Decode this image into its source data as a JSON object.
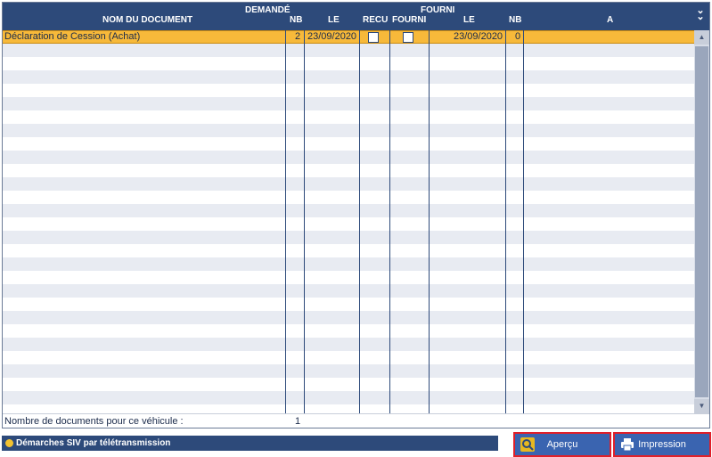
{
  "header": {
    "col_nom": "NOM DU DOCUMENT",
    "group_demande": "DEMANDÉ",
    "demande_nb": "NB",
    "demande_le": "LE",
    "col_recu": "RECU",
    "group_fourni": "FOURNI",
    "col_fourni": "FOURNI",
    "fourni_le": "LE",
    "fourni_nb": "NB",
    "col_a": "A"
  },
  "rows": [
    {
      "nom": "Déclaration de Cession (Achat)",
      "demande_nb": "2",
      "demande_le": "23/09/2020",
      "recu": false,
      "fourni": false,
      "fourni_le": "23/09/2020",
      "fourni_nb": "0",
      "a": ""
    }
  ],
  "footer": {
    "label": "Nombre de documents pour ce véhicule :",
    "count": "1"
  },
  "siv": {
    "label": "Démarches SIV par télétransmission"
  },
  "buttons": {
    "apercu": "Aperçu",
    "impression": "Impression"
  },
  "colors": {
    "header": "#2d4a7a",
    "selected_row": "#f7b93a",
    "button": "#3a64b0",
    "button_outline": "#e0202a"
  }
}
